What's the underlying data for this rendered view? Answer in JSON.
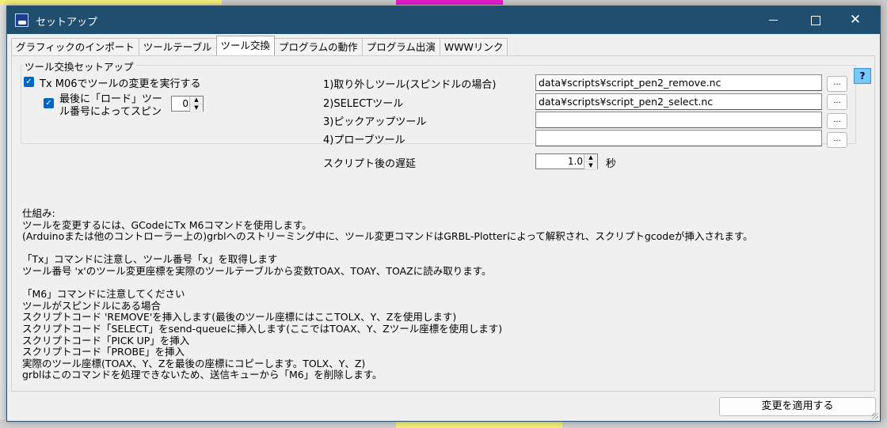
{
  "window": {
    "title": "セットアップ",
    "controls": {
      "minimize": "—",
      "maximize": "□",
      "close": "✕"
    }
  },
  "tabs": [
    {
      "label": "グラフィックのインポート",
      "active": false
    },
    {
      "label": "ツールテーブル",
      "active": false
    },
    {
      "label": "ツール交換",
      "active": true
    },
    {
      "label": "プログラムの動作",
      "active": false
    },
    {
      "label": "プログラム出演",
      "active": false
    },
    {
      "label": "WWWリンク",
      "active": false
    }
  ],
  "toolchange": {
    "group_label": "ツール交換セットアップ",
    "execute_m06": {
      "label": "Tx M06でツールの変更を実行する",
      "checked": true
    },
    "load_last": {
      "label_line1": "最後に「ロード」ツー",
      "label_line2": "ル番号によってスピン",
      "checked": true,
      "value": "0"
    },
    "scripts": [
      {
        "label": "1)取り外しツール(スピンドルの場合)",
        "value": "data¥scripts¥script_pen2_remove.nc",
        "browse": "..."
      },
      {
        "label": "2)SELECTツール",
        "value": "data¥scripts¥script_pen2_select.nc",
        "browse": "..."
      },
      {
        "label": "3)ピックアップツール",
        "value": "",
        "browse": "..."
      },
      {
        "label": "4)プローブツール",
        "value": "",
        "browse": "..."
      }
    ],
    "delay": {
      "label": "スクリプト後の遅延",
      "value": "1.0",
      "unit": "秒"
    },
    "help": "?"
  },
  "info_lines": [
    "仕組み:",
    "ツールを変更するには、GCodeにTx M6コマンドを使用します。",
    "(Arduinoまたは他のコントローラー上の)grblへのストリーミング中に、ツール変更コマンドはGRBL-Plotterによって解釈され、スクリプトgcodeが挿入されます。",
    "",
    "「Tx」コマンドに注意し、ツール番号「x」を取得します",
    "ツール番号 'x'のツール変更座標を実際のツールテーブルから変数TOAX、TOAY、TOAZに読み取ります。",
    "",
    "「M6」コマンドに注意してください",
    "ツールがスピンドルにある場合",
    "スクリプトコード 'REMOVE'を挿入します(最後のツール座標にはここTOLX、Y、Zを使用します)",
    "スクリプトコード「SELECT」をsend-queueに挿入します(ここではTOAX、Y、Zツール座標を使用します)",
    "スクリプトコード「PICK UP」を挿入",
    "スクリプトコード「PROBE」を挿入",
    "実際のツール座標(TOAX、Y、Zを最後の座標にコピーします。TOLX、Y、Z)",
    "grblはこのコマンドを処理できないため、送信キューから「M6」を削除します。"
  ],
  "footer": {
    "apply_label": "変更を適用する"
  }
}
